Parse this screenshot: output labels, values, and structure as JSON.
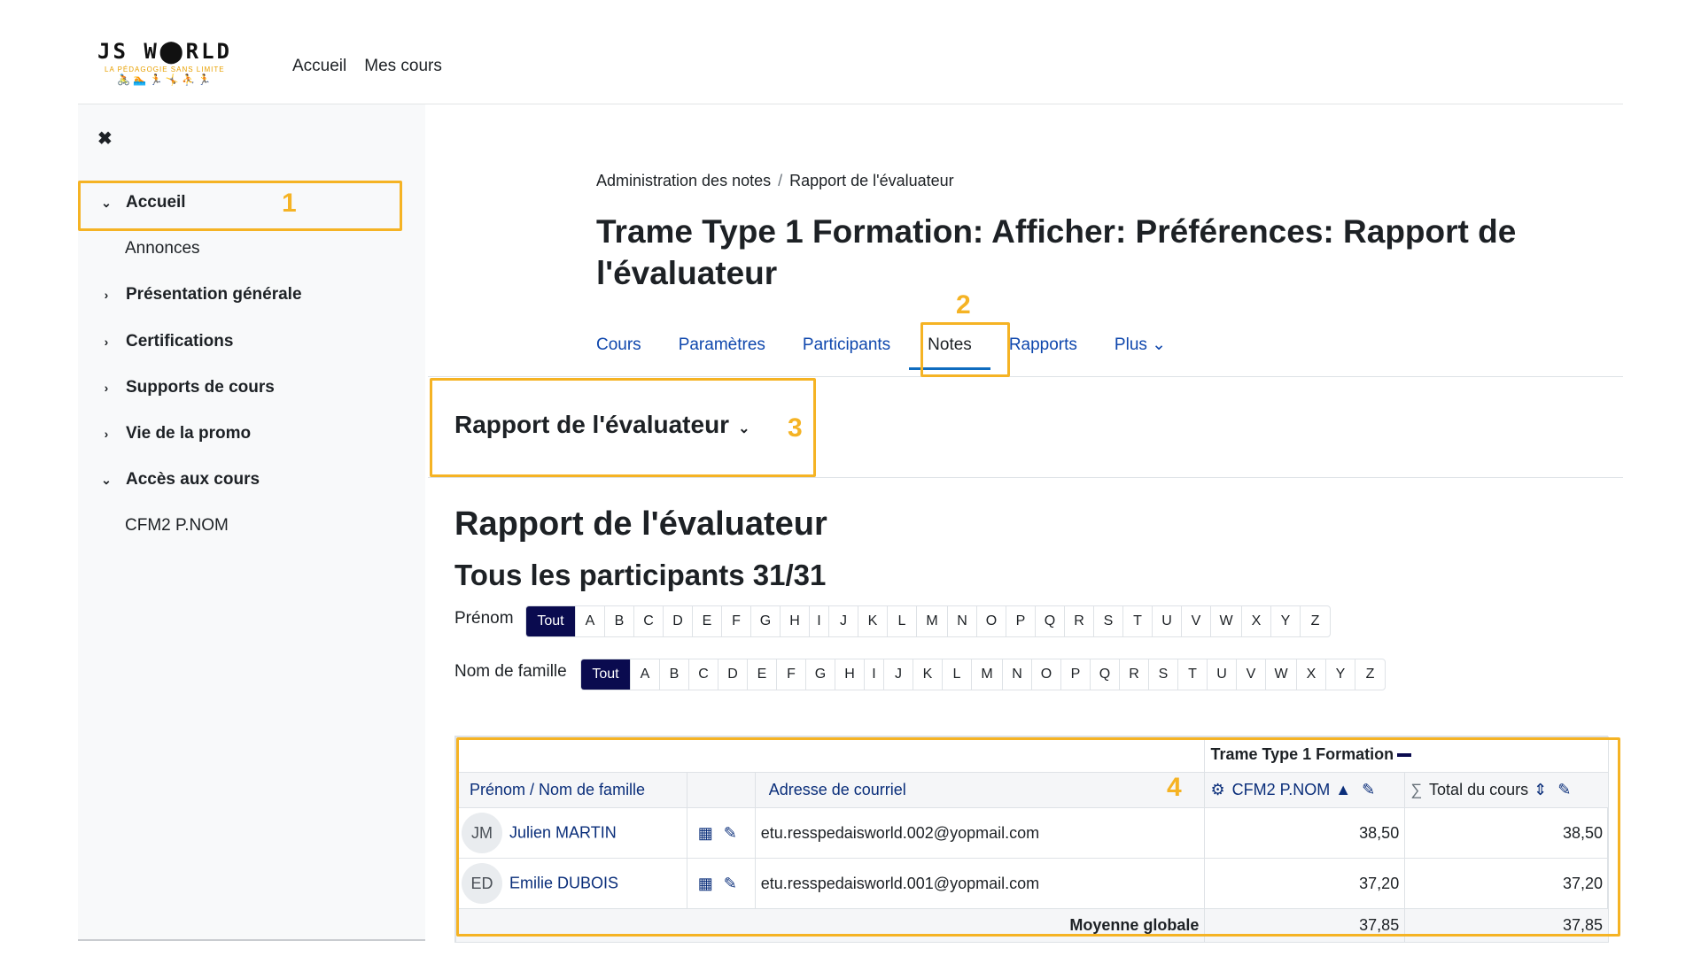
{
  "navbar": {
    "logo_title": "JS W⬤RLD",
    "logo_subtitle": "LA PÉDAGOGIE SANS LIMITE",
    "logo_figures": "🚴 🏊 🏃 🤸 ⛹ 🏃",
    "links": [
      "Accueil",
      "Mes cours"
    ]
  },
  "drawer": {
    "close_glyph": "✖",
    "items": [
      {
        "label": "Accueil",
        "chevron": "⌄",
        "bold": true
      },
      {
        "label": "Annonces"
      },
      {
        "label": "Présentation générale",
        "chevron": "›",
        "bold": true
      },
      {
        "label": "Certifications",
        "chevron": "›",
        "bold": true
      },
      {
        "label": "Supports de cours",
        "chevron": "›",
        "bold": true
      },
      {
        "label": "Vie de la promo",
        "chevron": "›",
        "bold": true
      },
      {
        "label": "Accès aux cours",
        "chevron": "⌄",
        "bold": true
      },
      {
        "label": "CFM2 P.NOM"
      }
    ]
  },
  "breadcrumb": {
    "item1": "Administration des notes",
    "separator": "/",
    "item2": "Rapport de l'évaluateur"
  },
  "page_title": "Trame Type 1 Formation: Afficher: Préférences: Rapport de l'évaluateur",
  "tabs": [
    "Cours",
    "Paramètres",
    "Participants",
    "Notes",
    "Rapports",
    "Plus ⌄"
  ],
  "active_tab": "Notes",
  "report_selector": {
    "label": "Rapport de l'évaluateur",
    "caret": "⌄"
  },
  "heading": "Rapport de l'évaluateur",
  "subheading": "Tous les participants 31/31",
  "filters": {
    "firstname_label": "Prénom",
    "lastname_label": "Nom de famille",
    "all_label": "Tout",
    "letters": [
      "A",
      "B",
      "C",
      "D",
      "E",
      "F",
      "G",
      "H",
      "I",
      "J",
      "K",
      "L",
      "M",
      "N",
      "O",
      "P",
      "Q",
      "R",
      "S",
      "T",
      "U",
      "V",
      "W",
      "X",
      "Y",
      "Z"
    ]
  },
  "grader": {
    "category": "Trame Type 1 Formation",
    "columns": {
      "name": "Prénom / Nom de famille",
      "email": "Adresse de courriel",
      "item": "CFM2 P.NOM",
      "total": "Total du cours"
    },
    "rows": [
      {
        "initials": "JM",
        "name": "Julien MARTIN",
        "email": "etu.resspedaisworld.002@yopmail.com",
        "item": "38,50",
        "total": "38,50"
      },
      {
        "initials": "ED",
        "name": "Emilie DUBOIS",
        "email": "etu.resspedaisworld.001@yopmail.com",
        "item": "37,20",
        "total": "37,20"
      }
    ],
    "average_label": "Moyenne globale",
    "average_item": "37,85",
    "average_total": "37,85"
  },
  "annotations": [
    "1",
    "2",
    "3",
    "4"
  ],
  "colors": {
    "highlight": "#f5b324",
    "accent_dark": "#0a0b4f",
    "link": "#0a2e7a"
  }
}
